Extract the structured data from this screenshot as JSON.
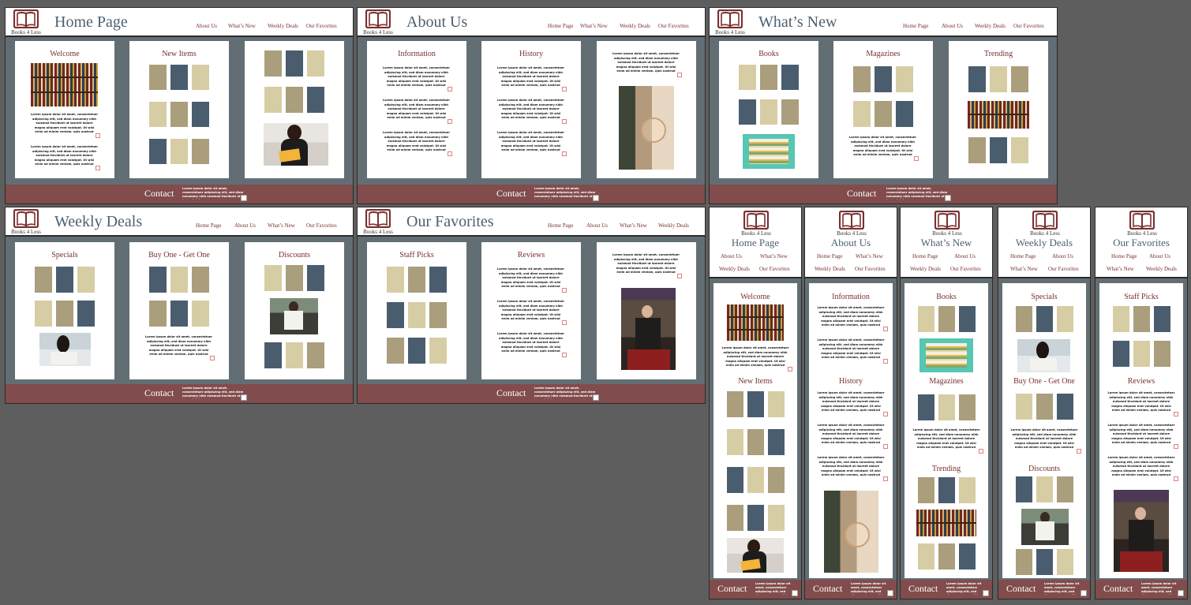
{
  "brand": {
    "logo_caption": "Books 4 Less"
  },
  "nav_labels": {
    "home": "Home Page",
    "about": "About Us",
    "new": "What’s New",
    "deals": "Weekly Deals",
    "fav": "Our Favorites"
  },
  "section_titles": {
    "welcome": "Welcome",
    "new_items": "New Items",
    "information": "Information",
    "history": "History",
    "books": "Books",
    "magazines": "Magazines",
    "trending": "Trending",
    "specials": "Specials",
    "bogo": "Buy One - Get One",
    "discounts": "Discounts",
    "staff_picks": "Staff Picks",
    "reviews": "Reviews"
  },
  "lorem": "Lorem ipsum dolor sit amet, consectetuer adipiscing elit, sed diam nonummy nibh euismod tincidunt ut laoreet dolore magna aliquam erat volutpat. Ut wisi enim ad minim veniam, quis nostrud exerci tation ullamcorper suscipit lobortis nisl ut aliquip",
  "footer": {
    "contact": "Contact",
    "text": "Lorem ipsum dolor sit amet, consectetuer adipiscing elit, sed diam nonummy nibh euismod tincidunt ut laoreet dolore"
  },
  "colors": {
    "canvas": "#5e5e5e",
    "board_background": "#626e74",
    "footer": "#824c4c",
    "heading_accent": "#7a3030",
    "title_slate": "#4d6170",
    "swatch_tan": "#aa9e7c",
    "swatch_slate": "#4a5d6e",
    "swatch_cream": "#d6cda4"
  },
  "icons": {
    "logo": "open-book-icon"
  }
}
